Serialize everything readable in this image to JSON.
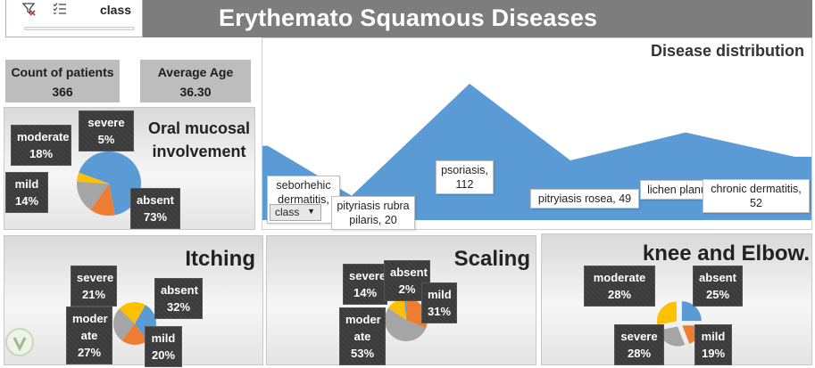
{
  "slicer": {
    "title": "class",
    "icons": [
      "clear-filter-icon",
      "multi-select-icon"
    ]
  },
  "header": {
    "title": "Erythemato Squamous Diseases"
  },
  "kpis": {
    "count_label": "Count of patients",
    "count_value": "366",
    "age_label": "Average Age",
    "age_value": "36.30"
  },
  "panels": {
    "oral": {
      "title_line1": "Oral mucosal",
      "title_line2": "involvement",
      "labels": [
        {
          "name": "moderate",
          "pct": "18%"
        },
        {
          "name": "severe",
          "pct": "5%"
        },
        {
          "name": "mild",
          "pct": "14%"
        },
        {
          "name": "absent",
          "pct": "73%"
        }
      ]
    },
    "itching": {
      "title": "Itching",
      "labels": [
        {
          "name": "severe",
          "pct": "21%"
        },
        {
          "name": "absent",
          "pct": "32%"
        },
        {
          "name_line1": "moder",
          "name_line2": "ate",
          "pct": "27%"
        },
        {
          "name": "mild",
          "pct": "20%"
        }
      ]
    },
    "scaling": {
      "title": "Scaling",
      "labels": [
        {
          "name": "severe",
          "pct": "14%"
        },
        {
          "name": "absent",
          "pct": "2%"
        },
        {
          "name": "mild",
          "pct": "31%"
        },
        {
          "name_line1": "moder",
          "name_line2": "ate",
          "pct": "53%"
        }
      ]
    },
    "knee": {
      "title": "knee and Elbow.",
      "labels": [
        {
          "name": "moderate",
          "pct": "28%"
        },
        {
          "name": "absent",
          "pct": "25%"
        },
        {
          "name": "severe",
          "pct": "28%"
        },
        {
          "name": "mild",
          "pct": "19%"
        }
      ]
    }
  },
  "distribution": {
    "title": "Disease distribution",
    "button_label": "class",
    "labels": {
      "seb_line1": "seborhehic",
      "seb_line2": "dermatitis, 61",
      "pit_rubra_line1": "pityriasis rubra",
      "pit_rubra_line2": "pilaris, 20",
      "psoriasis": "psoriasis, 112",
      "pit_rosea": "pitryiasis rosea, 49",
      "lichen": "lichen planus, 72",
      "chronic_line1": "chronic dermatitis,",
      "chronic_line2": "52"
    }
  },
  "colors": {
    "header": "#7d7d7d",
    "kpi": "#bdbdbd",
    "blue": "#5b9bd5",
    "orange": "#ed7d31",
    "gray": "#a5a5a5",
    "gold": "#ffc000",
    "label_bg": "#3a3a3a"
  },
  "chart_data": [
    {
      "type": "area",
      "title": "Disease distribution",
      "categories": [
        "seborhehic dermatitis",
        "pityriasis rubra pilaris",
        "psoriasis",
        "pitryiasis rosea",
        "lichen planus",
        "chronic dermatitis"
      ],
      "values": [
        61,
        20,
        112,
        49,
        72,
        52
      ]
    },
    {
      "type": "pie",
      "title": "Oral mucosal involvement",
      "categories": [
        "absent",
        "mild",
        "moderate",
        "severe"
      ],
      "values": [
        73,
        14,
        18,
        5
      ]
    },
    {
      "type": "pie",
      "title": "Itching",
      "categories": [
        "absent",
        "mild",
        "moderate",
        "severe"
      ],
      "values": [
        32,
        20,
        27,
        21
      ]
    },
    {
      "type": "pie",
      "title": "Scaling",
      "categories": [
        "absent",
        "mild",
        "moderate",
        "severe"
      ],
      "values": [
        2,
        31,
        53,
        14
      ]
    },
    {
      "type": "pie",
      "title": "knee and Elbow.",
      "categories": [
        "absent",
        "mild",
        "moderate",
        "severe"
      ],
      "values": [
        25,
        19,
        28,
        28
      ]
    }
  ]
}
